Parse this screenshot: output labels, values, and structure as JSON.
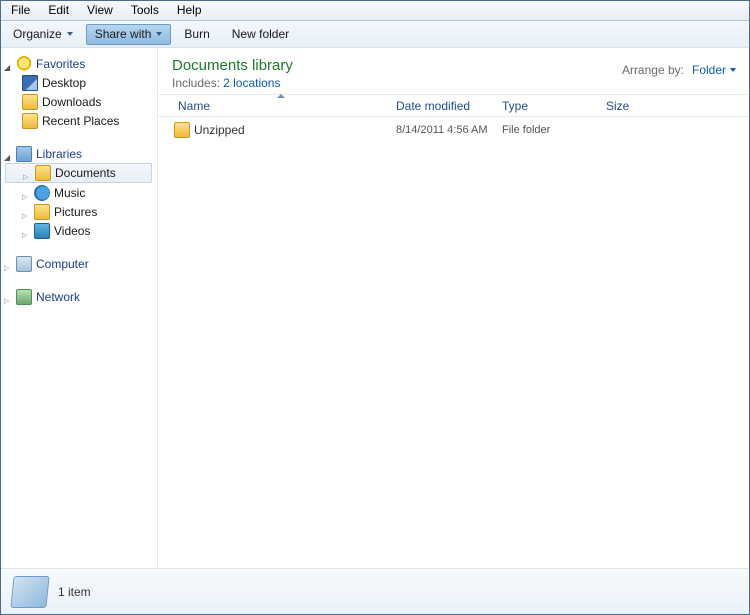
{
  "menu": [
    "File",
    "Edit",
    "View",
    "Tools",
    "Help"
  ],
  "toolbar": {
    "organize": "Organize",
    "share": "Share with",
    "burn": "Burn",
    "newfolder": "New folder"
  },
  "sidebar": {
    "favorites": {
      "label": "Favorites",
      "items": [
        "Desktop",
        "Downloads",
        "Recent Places"
      ]
    },
    "libraries": {
      "label": "Libraries",
      "items": [
        "Documents",
        "Music",
        "Pictures",
        "Videos"
      ],
      "selected": 0
    },
    "computer": "Computer",
    "network": "Network"
  },
  "header": {
    "title": "Documents library",
    "includes_label": "Includes:",
    "includes_link": "2 locations",
    "arrange_label": "Arrange by:",
    "arrange_value": "Folder"
  },
  "columns": {
    "name": "Name",
    "date": "Date modified",
    "type": "Type",
    "size": "Size"
  },
  "files": [
    {
      "name": "Unzipped",
      "date": "8/14/2011 4:56 AM",
      "type": "File folder",
      "size": ""
    }
  ],
  "status": {
    "count": "1 item"
  }
}
